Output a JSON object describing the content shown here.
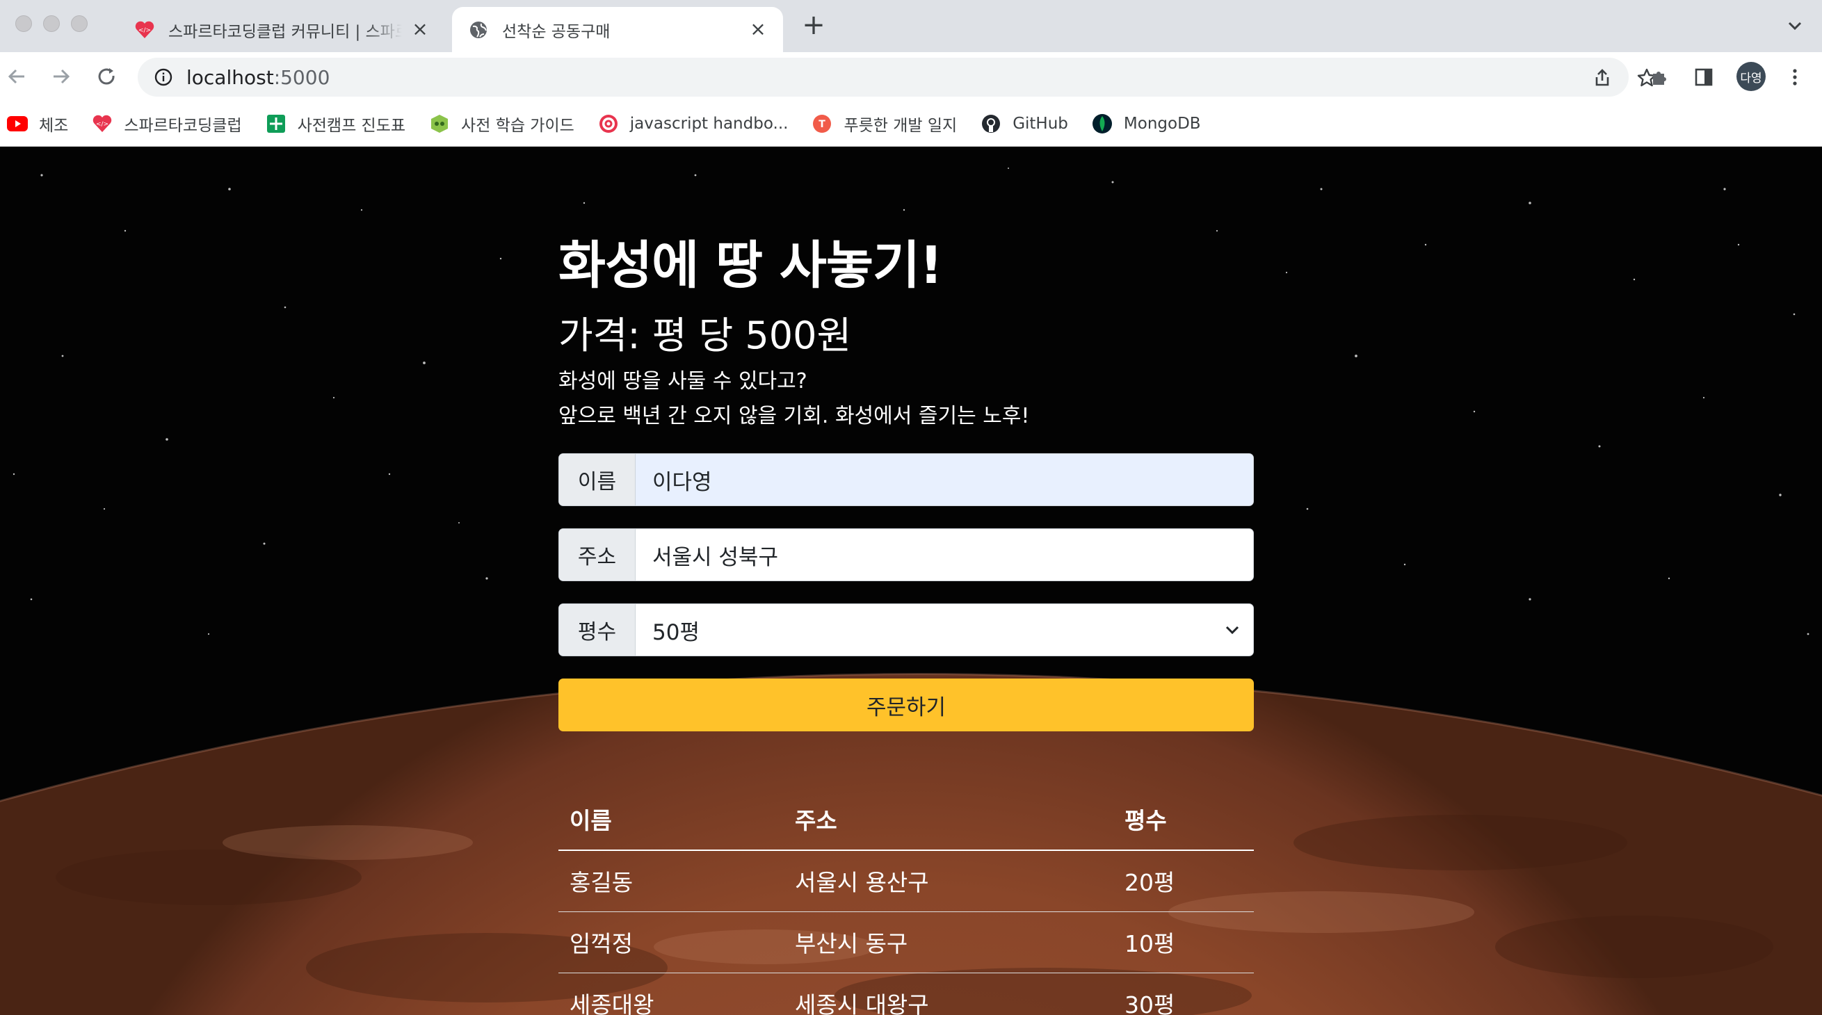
{
  "browser": {
    "tabs": [
      {
        "title": "스파르타코딩클럽 커뮤니티 | 스파르타코딩클럽",
        "active": false
      },
      {
        "title": "선착순 공동구매",
        "active": true
      }
    ],
    "url_host": "localhost",
    "url_port": ":5000",
    "profile_label": "다영",
    "bookmarks": [
      {
        "label": "체조",
        "icon": "youtube-icon",
        "color": "#ff0000"
      },
      {
        "label": "스파르타코딩클럽",
        "icon": "sparta-icon",
        "color": "#e8344e"
      },
      {
        "label": "사전캠프 진도표",
        "icon": "sheets-icon",
        "color": "#0f9d58"
      },
      {
        "label": "사전 학습 가이드",
        "icon": "notion-like-icon",
        "color": "#8bc34a"
      },
      {
        "label": "javascript handbo...",
        "icon": "target-icon",
        "color": "#e8344e"
      },
      {
        "label": "푸릇한 개발 일지",
        "icon": "velog-icon",
        "color": "#f15b49"
      },
      {
        "label": "GitHub",
        "icon": "github-icon",
        "color": "#24292f"
      },
      {
        "label": "MongoDB",
        "icon": "mongodb-icon",
        "color": "#13aa52"
      }
    ]
  },
  "page": {
    "title": "화성에 땅 사놓기!",
    "price": "가격: 평 당 500원",
    "desc_line1": "화성에 땅을 사둘 수 있다고?",
    "desc_line2": "앞으로 백년 간 오지 않을 기회. 화성에서 즐기는 노후!",
    "form": {
      "name_label": "이름",
      "name_value": "이다영",
      "address_label": "주소",
      "address_value": "서울시 성북구",
      "size_label": "평수",
      "size_value": "50평",
      "order_button": "주문하기"
    },
    "table": {
      "headers": [
        "이름",
        "주소",
        "평수"
      ],
      "rows": [
        [
          "홍길동",
          "서울시 용산구",
          "20평"
        ],
        [
          "임꺽정",
          "부산시 동구",
          "10평"
        ],
        [
          "세종대왕",
          "세종시 대왕구",
          "30평"
        ]
      ]
    }
  },
  "colors": {
    "order_button": "#ffc22a",
    "autofill": "#e8f0fe"
  }
}
